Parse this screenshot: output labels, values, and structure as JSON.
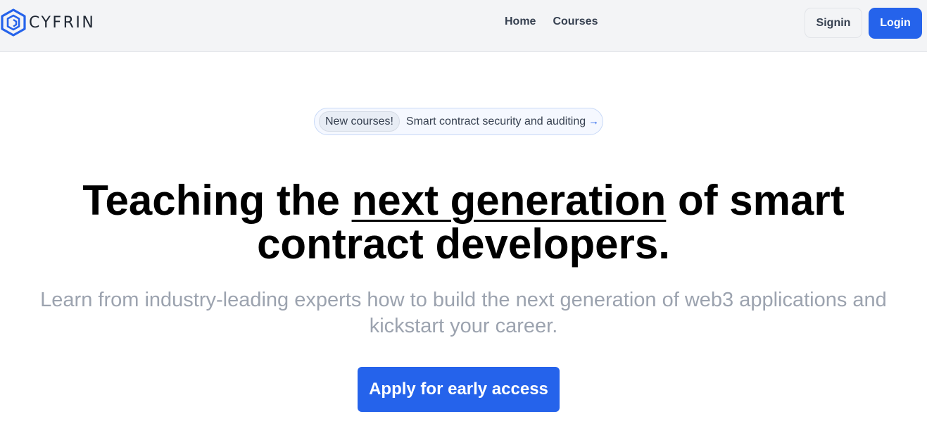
{
  "header": {
    "brand_name": "CYFRIN",
    "nav": [
      {
        "label": "Home"
      },
      {
        "label": "Courses"
      }
    ],
    "signin_label": "Signin",
    "login_label": "Login"
  },
  "announcement": {
    "badge": "New courses!",
    "text": "Smart contract security and auditing",
    "arrow": "→"
  },
  "hero": {
    "headline_before": "Teaching the ",
    "headline_highlight": "next generation",
    "headline_after": " of smart contract developers.",
    "subtitle": "Learn from industry-leading experts how to build the next generation of web3 applications and kickstart your career.",
    "cta_label": "Apply for early access"
  },
  "colors": {
    "accent": "#2563eb",
    "header_bg": "#f3f4f6",
    "subtitle": "#9ca3af",
    "nav_text": "#374151"
  },
  "icons": {
    "brand_logo": "cyfrin-shield-logo-icon",
    "announce_arrow": "arrow-right-icon"
  }
}
